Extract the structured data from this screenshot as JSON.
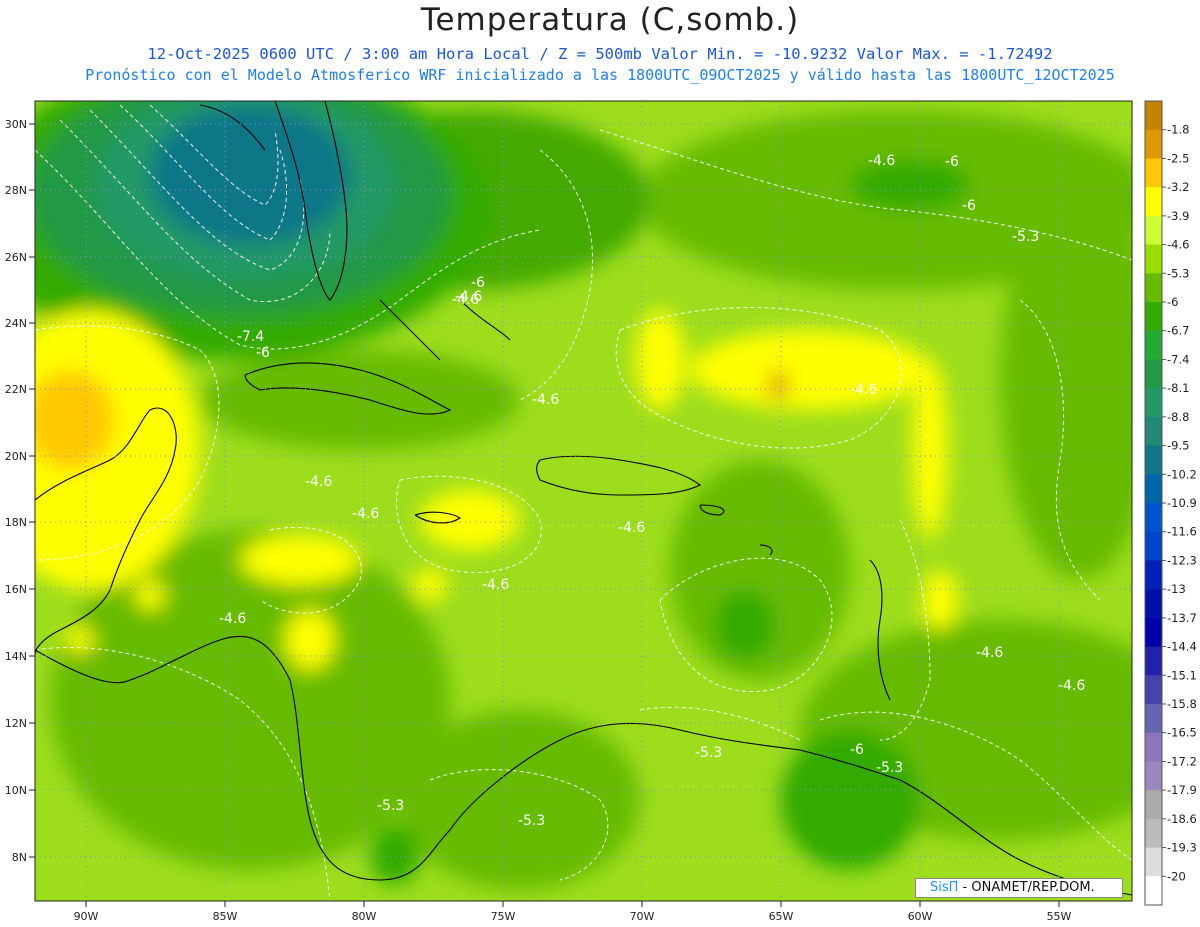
{
  "title": "Temperatura (C,somb.)",
  "subtitle1": "12-Oct-2025  0600 UTC / 3:00 am Hora Local / Z = 500mb  Valor Min. = -10.9232  Valor Max. = -1.72492",
  "subtitle2": "Pronóstico con el Modelo Atmosferico WRF inicializado a las 1800UTC_09OCT2025 y válido hasta las  1800UTC_12OCT2025",
  "credit": {
    "brand": "SisΠ",
    "text": " - ONAMET/REP.DOM."
  },
  "map": {
    "lon_range": [
      -92,
      -52
    ],
    "lat_range": [
      7,
      30.7
    ],
    "lon_ticks": [
      "90W",
      "85W",
      "80W",
      "75W",
      "70W",
      "65W",
      "60W",
      "55W"
    ],
    "lat_ticks": [
      "8N",
      "10N",
      "12N",
      "14N",
      "16N",
      "18N",
      "20N",
      "22N",
      "24N",
      "26N",
      "28N",
      "30N"
    ]
  },
  "contour_labels": [
    "-6",
    "-6",
    "-5.3",
    "-4.6",
    "-4.6",
    "-7.4",
    "-6",
    "-4.6",
    "-4.6",
    "-4.6",
    "-4.6",
    "-4.6",
    "-4.6",
    "-4.6",
    "-4.6",
    "-4.6",
    "-5.3",
    "-6",
    "-5.3",
    "-5.3",
    "-5.3",
    "-6",
    "-4.6"
  ],
  "legend": {
    "levels": [
      "-1.8",
      "-2.5",
      "-3.2",
      "-3.9",
      "-4.6",
      "-5.3",
      "-6",
      "-6.7",
      "-7.4",
      "-8.1",
      "-8.8",
      "-9.5",
      "-10.2",
      "-10.9",
      "-11.6",
      "-12.3",
      "-13",
      "-13.7",
      "-14.4",
      "-15.1",
      "-15.8",
      "-16.5",
      "-17.2",
      "-17.9",
      "-18.6",
      "-19.3",
      "-20"
    ],
    "colors": [
      "#c48400",
      "#e09800",
      "#ffc800",
      "#ffff00",
      "#ccff33",
      "#99dd00",
      "#66bb00",
      "#33aa00",
      "#22aa33",
      "#229944",
      "#229966",
      "#228877",
      "#117788",
      "#0066aa",
      "#0055cc",
      "#0044cc",
      "#0022bb",
      "#0011aa",
      "#0000aa",
      "#2222aa",
      "#4444aa",
      "#6666b0",
      "#8877bb",
      "#9988bb",
      "#aaaaaa",
      "#bbbbbb",
      "#dddddd",
      "#ffffff"
    ]
  }
}
